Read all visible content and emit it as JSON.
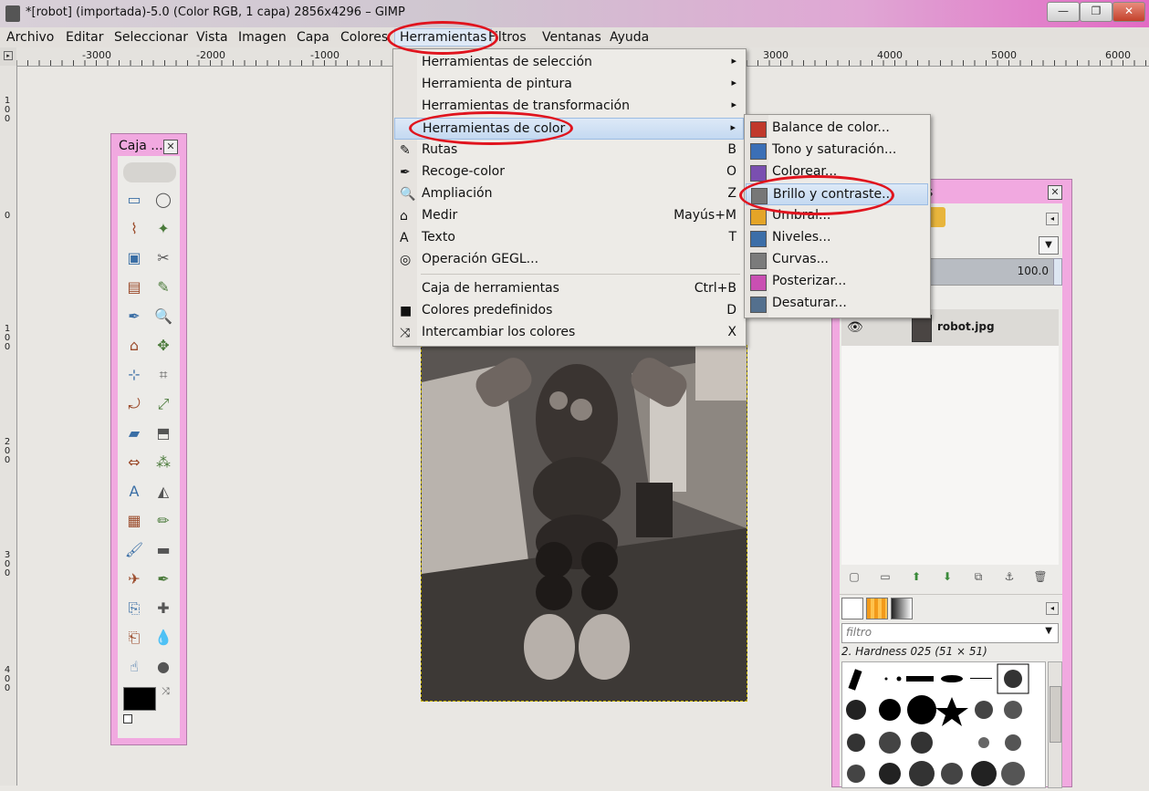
{
  "window": {
    "title": "*[robot] (importada)-5.0 (Color RGB, 1 capa) 2856x4296 – GIMP",
    "minimize": "—",
    "maximize": "❐",
    "close": "✕"
  },
  "menubar": [
    "Archivo",
    "Editar",
    "Seleccionar",
    "Vista",
    "Imagen",
    "Capa",
    "Colores",
    "Herramientas",
    "Filtros",
    "Ventanas",
    "Ayuda"
  ],
  "ruler": {
    "top_labels": [
      "-3000",
      "-2000",
      "-1000",
      "3000",
      "4000",
      "5000",
      "6000"
    ],
    "left_labels": [
      "1\n0\n0",
      "0",
      "1\n0\n0",
      "2\n0\n0",
      "3\n0\n0",
      "4\n0\n0"
    ]
  },
  "toolbox": {
    "title": "Caja ..."
  },
  "herramientas_menu": {
    "items": [
      {
        "label": "Herramientas de selección",
        "shortcut": "",
        "submenu": true
      },
      {
        "label": "Herramienta de pintura",
        "shortcut": "",
        "submenu": true
      },
      {
        "label": "Herramientas de transformación",
        "shortcut": "",
        "submenu": true
      },
      {
        "label": "Herramientas de color",
        "shortcut": "",
        "submenu": true
      },
      {
        "label": "Rutas",
        "shortcut": "B",
        "icon": "paths-icon"
      },
      {
        "label": "Recoge-color",
        "shortcut": "O",
        "icon": "color-picker-icon"
      },
      {
        "label": "Ampliación",
        "shortcut": "Z",
        "icon": "zoom-icon"
      },
      {
        "label": "Medir",
        "shortcut": "Mayús+M",
        "icon": "measure-icon"
      },
      {
        "label": "Texto",
        "shortcut": "T",
        "icon": "text-icon"
      },
      {
        "label": "Operación GEGL...",
        "shortcut": "",
        "icon": "gegl-icon"
      },
      {
        "label": "Caja de herramientas",
        "shortcut": "Ctrl+B"
      },
      {
        "label": "Colores predefinidos",
        "shortcut": "D",
        "icon": "default-colors-icon"
      },
      {
        "label": "Intercambiar los colores",
        "shortcut": "X",
        "icon": "swap-colors-icon"
      }
    ],
    "arrow": "▸"
  },
  "color_submenu": {
    "items": [
      {
        "label": "Balance de color...",
        "icon": "color-balance-icon"
      },
      {
        "label": "Tono y saturación...",
        "icon": "hue-saturation-icon"
      },
      {
        "label": "Colorear...",
        "icon": "colorize-icon"
      },
      {
        "label": "Brillo y contraste...",
        "icon": "brightness-contrast-icon"
      },
      {
        "label": "Umbral...",
        "icon": "threshold-icon"
      },
      {
        "label": "Niveles...",
        "icon": "levels-icon"
      },
      {
        "label": "Curvas...",
        "icon": "curves-icon"
      },
      {
        "label": "Posterizar...",
        "icon": "posterize-icon"
      },
      {
        "label": "Desaturar...",
        "icon": "desaturate-icon"
      }
    ]
  },
  "dock": {
    "title_fragment": "s",
    "opacity_value": "100.0",
    "layer_name": "robot.jpg",
    "filter_placeholder": "filtro",
    "brush_name": "2. Hardness 025 (51 × 51)"
  },
  "colors": {
    "highlight_red": "#e0141e",
    "window_pink": "#f1a9e0",
    "menu_bg": "#edebe7"
  }
}
